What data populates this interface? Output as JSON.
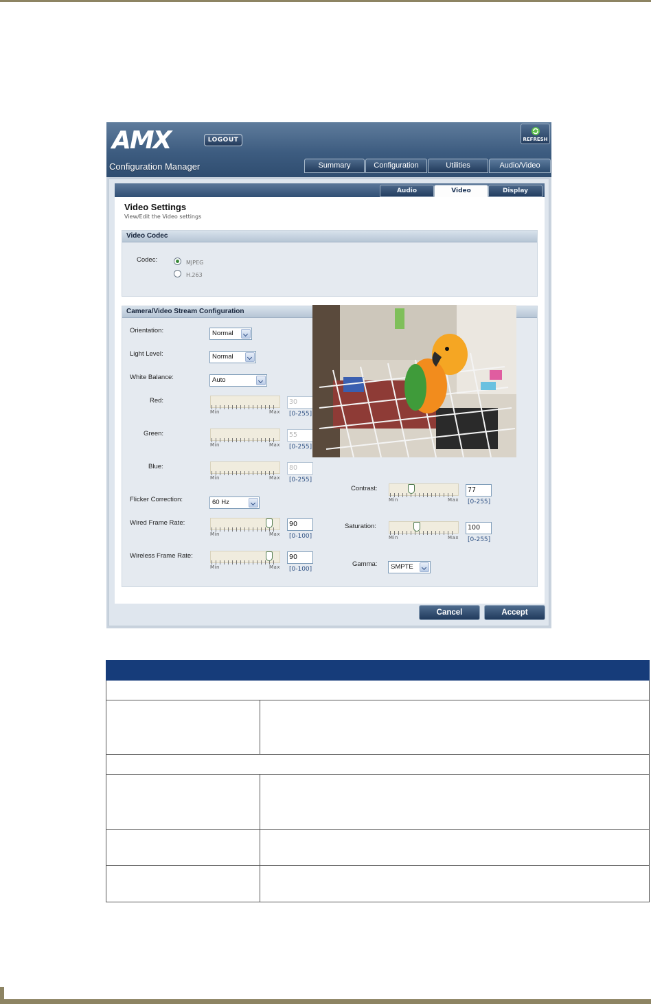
{
  "app": {
    "logo_text": "AMX",
    "logout_label": "LOGOUT",
    "refresh_label": "REFRESH",
    "title": "Configuration Manager",
    "main_tabs": [
      "Summary",
      "Configuration",
      "Utilities",
      "Audio/Video"
    ],
    "active_main_tab": "Audio/Video",
    "sub_tabs": [
      "Audio",
      "Video",
      "Display"
    ],
    "active_sub_tab": "Video"
  },
  "page": {
    "title": "Video Settings",
    "subtitle": "View/Edit the Video settings"
  },
  "video_codec": {
    "heading": "Video Codec",
    "codec_label": "Codec:",
    "options": [
      "MJPEG",
      "H.263"
    ],
    "selected": "MJPEG"
  },
  "stream": {
    "heading": "Camera/Video Stream Configuration",
    "orientation": {
      "label": "Orientation:",
      "value": "Normal"
    },
    "light_level": {
      "label": "Light Level:",
      "value": "Normal"
    },
    "white_balance": {
      "label": "White Balance:",
      "value": "Auto"
    },
    "red": {
      "label": "Red:",
      "value": "30",
      "range": "[0-255]",
      "min_label": "Min",
      "max_label": "Max"
    },
    "green": {
      "label": "Green:",
      "value": "55",
      "range": "[0-255]",
      "min_label": "Min",
      "max_label": "Max"
    },
    "blue": {
      "label": "Blue:",
      "value": "80",
      "range": "[0-255]",
      "min_label": "Min",
      "max_label": "Max"
    },
    "flicker": {
      "label": "Flicker Correction:",
      "value": "60 Hz"
    },
    "wired_frame_rate": {
      "label": "Wired Frame Rate:",
      "value": "90",
      "range": "[0-100]",
      "min_label": "Min",
      "max_label": "Max",
      "level": 0.9
    },
    "wireless_frame_rate": {
      "label": "Wireless Frame Rate:",
      "value": "90",
      "range": "[0-100]",
      "min_label": "Min",
      "max_label": "Max",
      "level": 0.9
    },
    "contrast": {
      "label": "Contrast:",
      "value": "77",
      "range": "[0-255]",
      "min_label": "Min",
      "max_label": "Max",
      "level": 0.3
    },
    "saturation": {
      "label": "Saturation:",
      "value": "100",
      "range": "[0-255]",
      "min_label": "Min",
      "max_label": "Max",
      "level": 0.39
    },
    "gamma": {
      "label": "Gamma:",
      "value": "SMPTE"
    }
  },
  "buttons": {
    "cancel": "Cancel",
    "accept": "Accept"
  },
  "colors": {
    "header_blue": "#2f4d70",
    "table_header": "#163c7a",
    "page_rule": "#8d8463"
  }
}
